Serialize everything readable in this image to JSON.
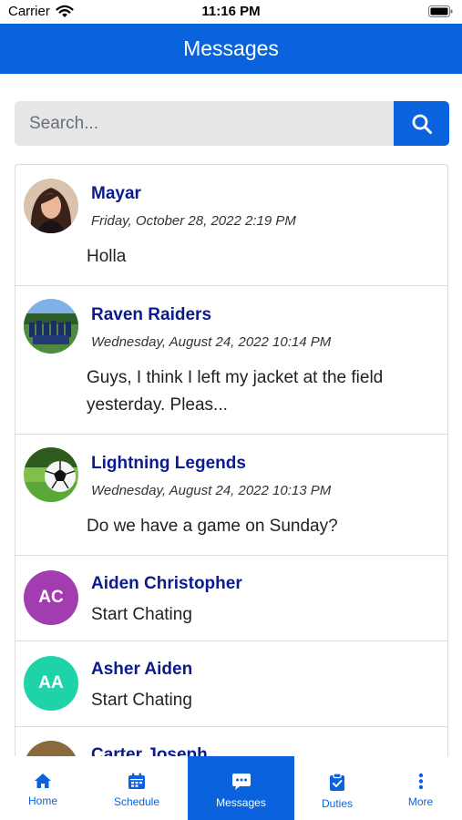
{
  "status_bar": {
    "carrier": "Carrier",
    "time": "11:16 PM"
  },
  "header": {
    "title": "Messages"
  },
  "search": {
    "placeholder": "Search...",
    "value": ""
  },
  "conversations": [
    {
      "name": "Mayar",
      "date": "Friday, October 28, 2022 2:19 PM",
      "message": "Holla",
      "avatar": "photo"
    },
    {
      "name": "Raven Raiders",
      "date": "Wednesday, August 24, 2022 10:14 PM",
      "message": "Guys, I think I left my jacket at the field yesterday. Pleas...",
      "avatar": "photo"
    },
    {
      "name": "Lightning Legends",
      "date": "Wednesday, August 24, 2022 10:13 PM",
      "message": "Do we have a game on Sunday?",
      "avatar": "photo"
    },
    {
      "name": "Aiden Christopher",
      "subtitle": "Start Chating",
      "initials": "AC",
      "avatar_color": "#a33cb0"
    },
    {
      "name": "Asher Aiden",
      "subtitle": "Start Chating",
      "initials": "AA",
      "avatar_color": "#1fd3a9"
    },
    {
      "name": "Carter Joseph",
      "avatar_color": "#8a6a3a"
    }
  ],
  "tabs": [
    {
      "label": "Home",
      "icon": "home-icon"
    },
    {
      "label": "Schedule",
      "icon": "calendar-icon"
    },
    {
      "label": "Messages",
      "icon": "chat-icon",
      "active": true
    },
    {
      "label": "Duties",
      "icon": "clipboard-icon"
    },
    {
      "label": "More",
      "icon": "more-vertical-icon"
    }
  ],
  "colors": {
    "primary": "#0a63dc",
    "name_text": "#0b1a8c"
  }
}
